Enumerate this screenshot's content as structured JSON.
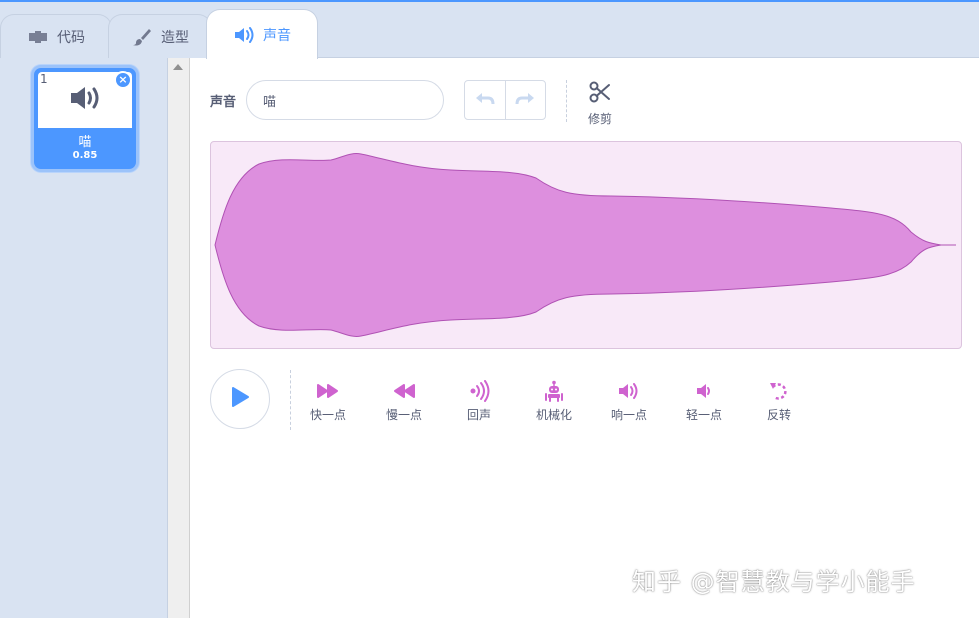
{
  "tabs": [
    {
      "label": "代码",
      "icon": "code-icon"
    },
    {
      "label": "造型",
      "icon": "brush-icon"
    },
    {
      "label": "声音",
      "icon": "speaker-icon",
      "active": true
    }
  ],
  "sound_list": [
    {
      "index": "1",
      "name": "喵",
      "duration": "0.85",
      "icon": "speaker-icon",
      "selected": true
    }
  ],
  "editor": {
    "sound_label": "声音",
    "sound_name_value": "喵",
    "trim_label": "修剪"
  },
  "effects": [
    {
      "label": "快一点",
      "icon": "faster-icon"
    },
    {
      "label": "慢一点",
      "icon": "slower-icon"
    },
    {
      "label": "回声",
      "icon": "echo-icon"
    },
    {
      "label": "机械化",
      "icon": "robot-icon"
    },
    {
      "label": "响一点",
      "icon": "louder-icon"
    },
    {
      "label": "轻一点",
      "icon": "softer-icon"
    },
    {
      "label": "反转",
      "icon": "reverse-icon"
    }
  ],
  "watermark": "知乎 @智慧教与学小能手",
  "colors": {
    "accent": "#4c97ff",
    "sound": "#cf63cf",
    "waveform_fill": "#dd8fde",
    "waveform_bg": "#f8e9f8"
  }
}
